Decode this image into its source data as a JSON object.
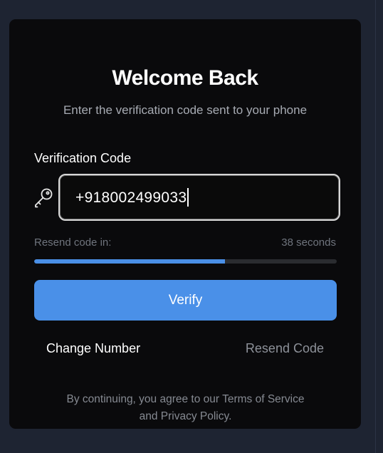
{
  "card": {
    "title": "Welcome Back",
    "subtitle": "Enter the verification code sent to your phone"
  },
  "form": {
    "label": "Verification Code",
    "input_value": "+918002499033",
    "icon": "key-icon"
  },
  "resend": {
    "label": "Resend code in:",
    "timer": "38 seconds",
    "progress_fraction": 0.63
  },
  "actions": {
    "verify_label": "Verify",
    "change_number_label": "Change Number",
    "resend_code_label": "Resend Code"
  },
  "footer": {
    "line1": "By continuing, you agree to our Terms of Service",
    "line2": "and Privacy Policy."
  },
  "colors": {
    "accent": "#4a90e8",
    "card_background": "#0a0a0c",
    "page_background": "#1e2432"
  }
}
